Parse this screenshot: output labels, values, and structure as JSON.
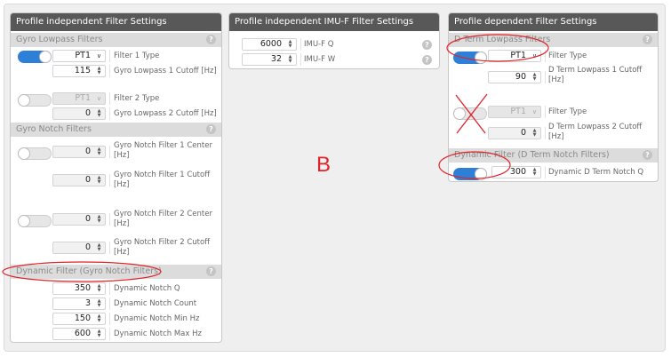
{
  "panel_left": {
    "title": "Profile independent Filter Settings",
    "gyro_lowpass": {
      "header": "Gyro Lowpass Filters",
      "filter1_type_value": "PT1",
      "filter1_type_label": "Filter 1 Type",
      "cutoff1_value": "115",
      "cutoff1_label": "Gyro Lowpass 1 Cutoff [Hz]",
      "filter2_type_value": "PT1",
      "filter2_type_label": "Filter 2 Type",
      "cutoff2_value": "0",
      "cutoff2_label": "Gyro Lowpass 2 Cutoff [Hz]"
    },
    "gyro_notch": {
      "header": "Gyro Notch Filters",
      "n1_center_value": "0",
      "n1_center_label_a": "Gyro Notch Filter 1 Center",
      "n1_center_label_b": "[Hz]",
      "n1_cutoff_value": "0",
      "n1_cutoff_label_a": "Gyro Notch Filter 1 Cutoff",
      "n1_cutoff_label_b": "[Hz]",
      "n2_center_value": "0",
      "n2_center_label_a": "Gyro Notch Filter 2 Center",
      "n2_center_label_b": "[Hz]",
      "n2_cutoff_value": "0",
      "n2_cutoff_label_a": "Gyro Notch Filter 2 Cutoff",
      "n2_cutoff_label_b": "[Hz]"
    },
    "dyn_notch": {
      "header": "Dynamic Filter (Gyro Notch Filters)",
      "q_value": "350",
      "q_label": "Dynamic Notch Q",
      "count_value": "3",
      "count_label": "Dynamic Notch Count",
      "min_value": "150",
      "min_label": "Dynamic Notch Min Hz",
      "max_value": "600",
      "max_label": "Dynamic Notch Max Hz"
    }
  },
  "panel_mid": {
    "title": "Profile independent IMU-F Filter Settings",
    "q_value": "6000",
    "q_label": "IMU-F Q",
    "w_value": "32",
    "w_label": "IMU-F W"
  },
  "panel_right": {
    "title": "Profile dependent Filter Settings",
    "dterm_lowpass": {
      "header": "D Term Lowpass Filters",
      "filter1_type_value": "PT1",
      "filter1_type_label": "Filter Type",
      "cutoff1_value": "90",
      "cutoff1_label_a": "D Term Lowpass 1 Cutoff",
      "cutoff1_label_b": "[Hz]",
      "filter2_type_value": "PT1",
      "filter2_type_label": "Filter Type",
      "cutoff2_value": "0",
      "cutoff2_label_a": "D Term Lowpass 2 Cutoff",
      "cutoff2_label_b": "[Hz]"
    },
    "dyn_dterm": {
      "header": "Dynamic Filter (D Term Notch Filters)",
      "q_value": "300",
      "q_label": "Dynamic D Term Notch Q"
    }
  },
  "annotation_letter": "B",
  "icons": {
    "help": "?",
    "chevron": "∨",
    "spin_up": "▲",
    "spin_down": "▼"
  },
  "colors": {
    "accent": "#2e7fd7",
    "header_bg": "#585858",
    "annotation_red": "#e0222a"
  }
}
